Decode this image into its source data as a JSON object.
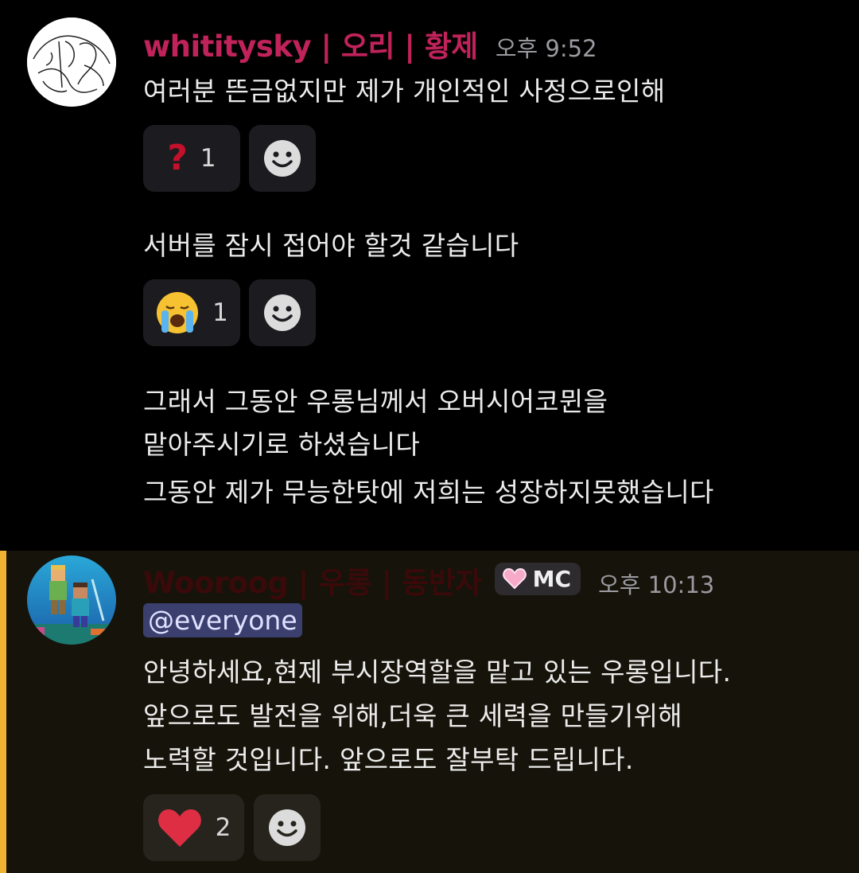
{
  "message1": {
    "author": "whititysky | 오리 | 황제",
    "timestamp": "오후 9:52",
    "author_color": "#c0225a",
    "lines": [
      "여러분 뜬금없지만 제가 개인적인 사정으로인해",
      "서버를 잠시 접어야 할것 같습니다",
      "그래서 그동안 우롱님께서 오버시어코뮌을",
      "맡아주시기로 하셨습니다",
      "그동안 제가 무능한탓에 저희는 성장하지못했습니다"
    ],
    "reactions": [
      {
        "emoji": "❓",
        "icon": "question-mark-icon",
        "count": "1"
      },
      {
        "emoji": "😭",
        "icon": "crying-face-icon",
        "count": "1"
      }
    ]
  },
  "message2": {
    "author": "Wooroog | 우롱 | 동반자",
    "author_color": "#3a0a0a",
    "badge": "MC",
    "badge_icon": "pink-heart-icon",
    "timestamp": "오후 10:13",
    "mention": "@everyone",
    "mention_highlight": "#f0b232",
    "lines": [
      "안녕하세요,현제 부시장역할을 맡고 있는 우롱입니다.",
      "앞으로도 발전을 위해,더욱 큰 세력을 만들기위해",
      "노력할 것입니다. 앞으로도 잘부탁 드립니다."
    ],
    "reactions": [
      {
        "emoji": "❤️",
        "icon": "red-heart-icon",
        "count": "2"
      }
    ]
  }
}
